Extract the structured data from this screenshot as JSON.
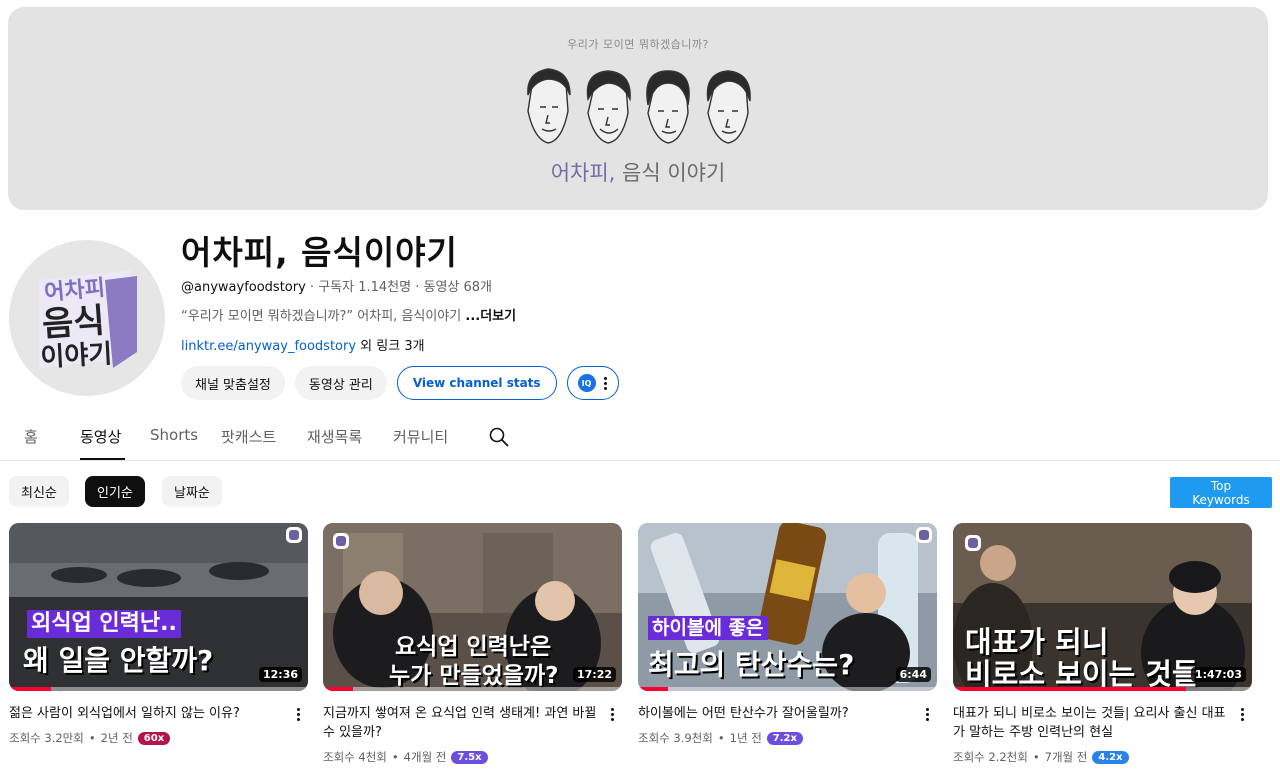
{
  "banner": {
    "tagline": "우리가 모이면 뭐하겠습니까?",
    "title_accent": "어차피,",
    "title_rest": " 음식 이야기"
  },
  "channel": {
    "name": "어차피, 음식이야기",
    "avatar_text": [
      "어차피",
      "음식",
      "이야기"
    ],
    "handle": "@anywayfoodstory",
    "subscribers": "구독자 1.14천명",
    "videos": "동영상 68개",
    "sep": " ‧ ",
    "description": "“우리가 모이면 뭐하겠습니까?” 어차피, 음식이야기 ",
    "more": "...더보기",
    "link": "linktr.ee/anyway_foodstory",
    "link_extra_prefix": " 외 ",
    "link_extra": "링크 3개"
  },
  "buttons": {
    "customize": "채널 맞춤설정",
    "manage": "동영상 관리",
    "stats": "View channel stats",
    "ext_logo": "IQ"
  },
  "tabs": [
    "홈",
    "동영상",
    "Shorts",
    "팟캐스트",
    "재생목록",
    "커뮤니티"
  ],
  "active_tab": "동영상",
  "sort_chips": [
    "최신순",
    "인기순",
    "날짜순"
  ],
  "active_chip": "인기순",
  "top_keywords": [
    "Top",
    "Keywords"
  ],
  "videos": [
    {
      "cap1": "외식업 인력난..",
      "cap2": "왜 일을 안할까?",
      "duration": "12:36",
      "progress": 0.14,
      "title": "젊은 사람이 외식업에서 일하지 않는 이유?",
      "views": "조회수 3.2만회",
      "age": "2년 전",
      "mult": "60x",
      "mult_color": "#b3134a"
    },
    {
      "cap1": "요식업 인력난은",
      "cap2": "누가 만들었을까?",
      "duration": "17:22",
      "progress": 0.1,
      "title": "지금까지 쌓여져 온 요식업 인력 생태계! 과연 바뀔 수 있을까?",
      "views": "조회수 4천회",
      "age": "4개월 전",
      "mult": "7.5x",
      "mult_color": "#6c4fe0"
    },
    {
      "cap1": "하이볼에 좋은",
      "cap2": "최고의 탄산수는?",
      "duration": "6:44",
      "progress": 0.1,
      "title": "하이볼에는 어떤 탄산수가 잘어울릴까?",
      "views": "조회수 3.9천회",
      "age": "1년 전",
      "mult": "7.2x",
      "mult_color": "#6c4fe0"
    },
    {
      "cap1": "대표가 되니",
      "cap2": "비로소 보이는 것들",
      "duration": "1:47:03",
      "progress": 0.78,
      "title": "대표가 되니 비로소 보이는 것들| 요리사 출신 대표가 말하는 주방 인력난의 현실",
      "views": "조회수 2.2천회",
      "age": "7개월 전",
      "mult": "4.2x",
      "mult_color": "#2a82e8"
    }
  ]
}
